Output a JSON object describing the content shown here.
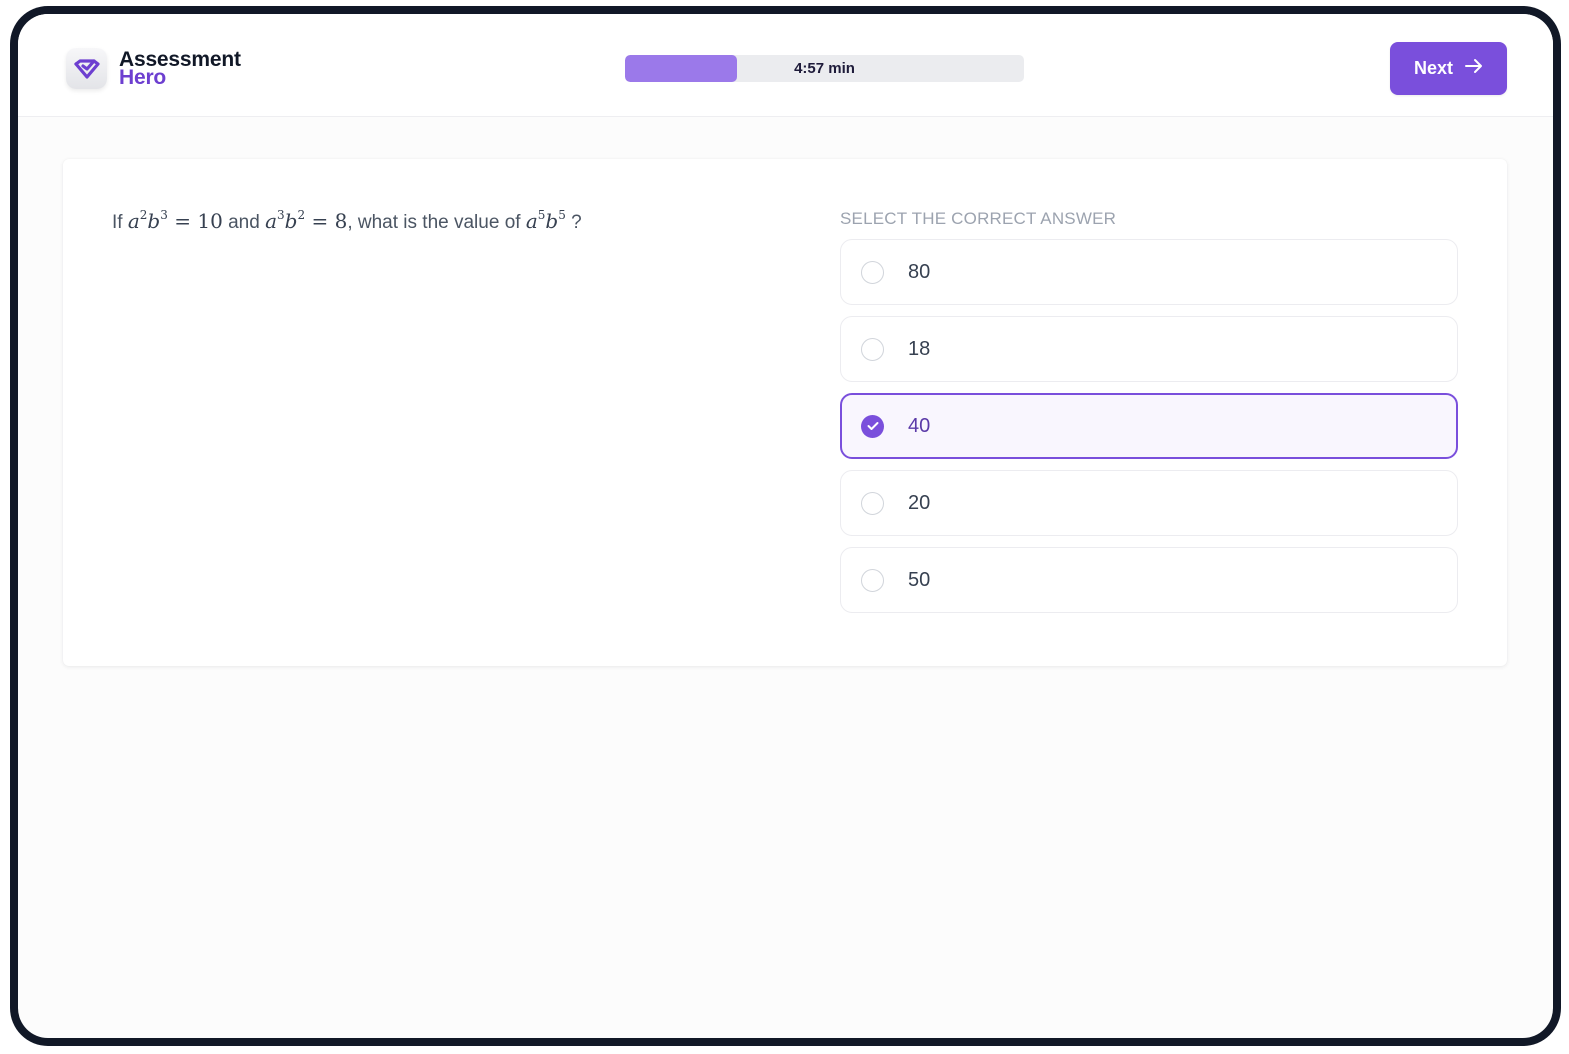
{
  "app": {
    "logo_line1": "Assessment",
    "logo_line2": "Hero",
    "logo_icon": "checkmark-shield-icon",
    "brand_color": "#7a4fdc"
  },
  "header": {
    "timer": {
      "label": "4:57 min",
      "progress_percent": 28
    },
    "next_button": {
      "label": "Next",
      "icon": "arrow-right-icon"
    }
  },
  "question": {
    "prefix": "If",
    "eq1": {
      "base1": "a",
      "exp1": "2",
      "base2": "b",
      "exp2": "3",
      "rhs": "10"
    },
    "connector": "and",
    "eq2": {
      "base1": "a",
      "exp1": "3",
      "base2": "b",
      "exp2": "2",
      "rhs": "8"
    },
    "middle": ", what is the value of",
    "target": {
      "base1": "a",
      "exp1": "5",
      "base2": "b",
      "exp2": "5"
    },
    "suffix": "?"
  },
  "answers": {
    "heading": "SELECT THE CORRECT ANSWER",
    "selected_index": 2,
    "options": [
      {
        "label": "80",
        "selected": false
      },
      {
        "label": "18",
        "selected": false
      },
      {
        "label": "40",
        "selected": true
      },
      {
        "label": "20",
        "selected": false
      },
      {
        "label": "50",
        "selected": false
      }
    ]
  }
}
